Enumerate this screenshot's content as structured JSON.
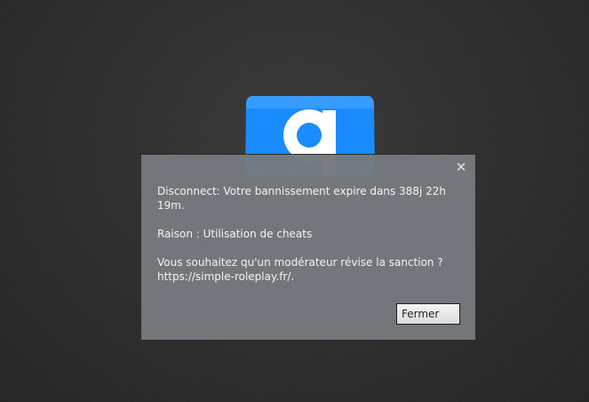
{
  "logo": {
    "letter": "g",
    "color": "#1a8cff",
    "icon": "gmod-logo-icon"
  },
  "dialog": {
    "close_glyph": "✕",
    "message": "Disconnect: Votre bannissement expire dans 388j 22h\n19m.\n\nRaison : Utilisation de cheats\n\nVous souhaitez qu'un modérateur révise la sanction ?\nhttps://simple-roleplay.fr/.",
    "button_label": "Fermer"
  },
  "colors": {
    "background": "#2e2e2e",
    "dialog_bg": "#767a7f",
    "text": "#f2f3f4"
  }
}
